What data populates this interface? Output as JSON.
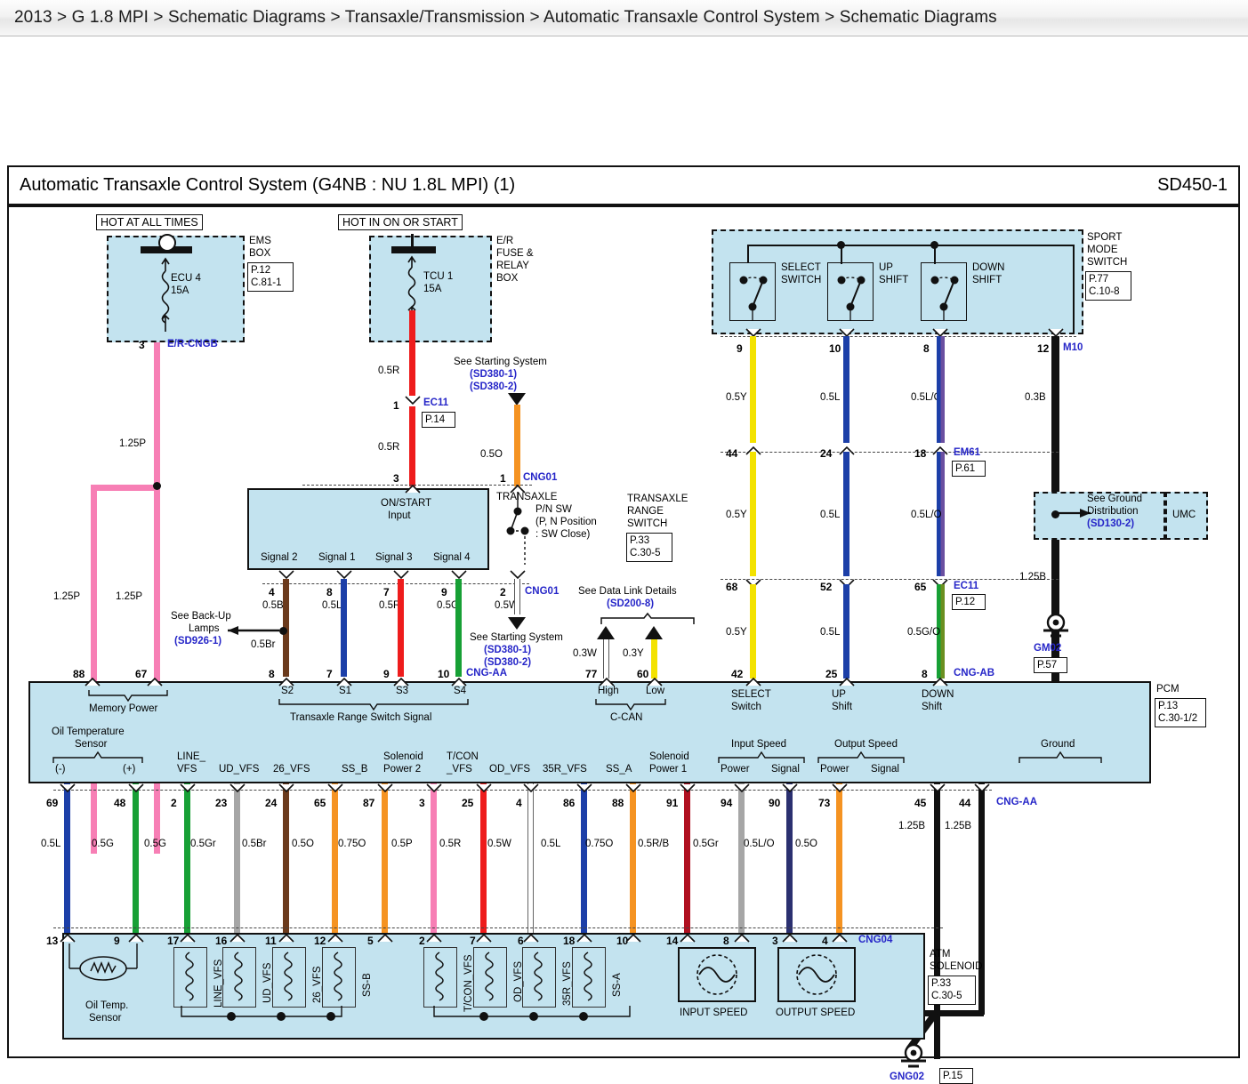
{
  "breadcrumb": {
    "text": "2013 > G 1.8 MPI > Schematic Diagrams > Transaxle/Transmission > Automatic Transaxle Control System > Schematic Diagrams"
  },
  "diagram": {
    "title": "Automatic Transaxle Control System (G4NB : NU 1.8L MPI) (1)",
    "sheet_code": "SD450-1"
  },
  "fuse_boxes": [
    {
      "banner": "HOT AT ALL TIMES",
      "fuse_name": "ECU 4",
      "fuse_rating": "15A",
      "box_name": "EMS\nBOX",
      "box_name_l1": "EMS",
      "box_name_l2": "BOX",
      "ref_page": "P.12",
      "ref_conn": "C.81-1",
      "out_pin": "3",
      "out_connector": "E/R-CNGB"
    },
    {
      "banner": "HOT IN ON OR START",
      "fuse_name": "TCU 1",
      "fuse_rating": "15A",
      "box_name_l1": "E/R",
      "box_name_l2": "FUSE &",
      "box_name_l3": "RELAY",
      "box_name_l4": "BOX",
      "out_wire": "0.5R"
    }
  ],
  "sport_mode_switch": {
    "title_l1": "SPORT",
    "title_l2": "MODE",
    "title_l3": "SWITCH",
    "ref_page": "P.77",
    "ref_conn": "C.10-8",
    "switches": [
      {
        "name_l1": "SELECT",
        "name_l2": "SWITCH",
        "pin": "9",
        "wire": "0.5Y",
        "color": "#f3e200"
      },
      {
        "name_l1": "UP",
        "name_l2": "SHIFT",
        "pin": "10",
        "wire": "0.5L",
        "color": "#1c3fa8"
      },
      {
        "name_l1": "DOWN",
        "name_l2": "SHIFT",
        "pin": "8",
        "wire": "0.5L/O",
        "color": "#1c3fa8"
      }
    ],
    "ground_pin": "12",
    "ground_connector": "M10",
    "ground_wire": "0.3B"
  },
  "mid_connectors": {
    "em61": {
      "name": "EM61",
      "page": "P.61",
      "pins": [
        "44",
        "24",
        "18"
      ]
    },
    "ec11_right": {
      "name": "EC11",
      "page": "P.12",
      "pins": [
        "68",
        "52",
        "65"
      ]
    },
    "cng_ab": {
      "name": "CNG-AB",
      "pins": [
        "42",
        "25",
        "8"
      ]
    },
    "wires_mid": [
      "0.5Y",
      "0.5L",
      "0.5L/O"
    ],
    "wires_low": [
      "0.5Y",
      "0.5L",
      "0.5G/O"
    ]
  },
  "ground_distribution": {
    "note_l1": "See Ground",
    "note_l2": "Distribution",
    "note_ref": "(SD130-2)",
    "box_label": "UMC",
    "wire_lower": "1.25B",
    "ground_name": "GM02",
    "ground_page": "P.57"
  },
  "transaxle_range_switch": {
    "title_l1": "TRANSAXLE",
    "title_l2": "RANGE",
    "title_l3": "SWITCH",
    "ref_page": "P.33",
    "ref_conn": "C.30-5",
    "on_start_l1": "ON/START",
    "on_start_l2": "Input",
    "pn_sw_l1": "P/N SW",
    "pn_sw_l2": "(P, N Position",
    "pn_sw_l3": ": SW Close)",
    "signal_labels": [
      "Signal 2",
      "Signal 1",
      "Signal 3",
      "Signal 4"
    ],
    "top_pins": {
      "on_start": "3",
      "pn_sw": "1"
    },
    "top_connector": "CNG01",
    "ec11": {
      "name": "EC11",
      "page": "P.14",
      "pin": "1"
    },
    "wire_in_upper": "0.5R",
    "wire_in_lower": "0.5R",
    "wire_pn": "0.5O",
    "starting_note_l1": "See Starting System",
    "starting_note_ref1": "(SD380-1)",
    "starting_note_ref2": "(SD380-2)",
    "out_pins": [
      "4",
      "8",
      "7",
      "9"
    ],
    "out_wires": [
      "0.5Br",
      "0.5L",
      "0.5R",
      "0.5G"
    ],
    "pn_out_pin": "2",
    "pn_out_wire": "0.5W",
    "pn_out_connector": "CNG01"
  },
  "backup_lamps": {
    "note_l1": "See Back-Up",
    "note_l2": "Lamps",
    "note_ref": "(SD926-1)",
    "wire_above": "0.5Br",
    "wire_below": "0.5Br"
  },
  "data_link": {
    "note": "See Data Link Details",
    "note_ref": "(SD200-8)",
    "wires": [
      "0.3W",
      "0.3Y"
    ],
    "pins": [
      "77",
      "60"
    ]
  },
  "memory_power": {
    "wire_top": "1.25P",
    "wire_left": "1.25P",
    "wire_right": "1.25P",
    "pins": [
      "88",
      "67"
    ]
  },
  "pcm": {
    "name": "PCM",
    "ref_page": "P.13",
    "ref_conn": "C.30-1/2",
    "top_groups": [
      {
        "label": "Memory Power",
        "sub": []
      },
      {
        "label": "Transaxle Range Switch Signal",
        "sub": [
          "S2",
          "S1",
          "S3",
          "S4"
        ]
      },
      {
        "label": "C-CAN",
        "sub": [
          "High",
          "Low"
        ]
      }
    ],
    "top_single": [
      {
        "l1": "SELECT",
        "l2": "Switch"
      },
      {
        "l1": "UP",
        "l2": "Shift"
      },
      {
        "l1": "DOWN",
        "l2": "Shift"
      }
    ],
    "bottom_groups": [
      {
        "label_l1": "Oil Temperature",
        "label_l2": "Sensor",
        "sub": [
          "(-)",
          "(+)"
        ]
      },
      {
        "label_l1": "Input Speed",
        "sub": [
          "Power",
          "Signal"
        ]
      },
      {
        "label_l1": "Output Speed",
        "sub": [
          "Power",
          "Signal"
        ]
      },
      {
        "label_l1": "Ground",
        "sub": []
      }
    ],
    "bottom_pin_labels": [
      "LINE_\nVFS",
      "UD_VFS",
      "26_VFS",
      "SS_B",
      "Solenoid\nPower 2",
      "T/CON\n_VFS",
      "OD_VFS",
      "35R_VFS",
      "SS_A",
      "Solenoid\nPower 1"
    ],
    "top_pins_left": [
      "88",
      "67",
      "8",
      "7",
      "9",
      "10",
      "77",
      "60",
      "42",
      "25",
      "8"
    ],
    "bottom_pins": [
      "69",
      "48",
      "2",
      "23",
      "24",
      "65",
      "87",
      "3",
      "25",
      "4",
      "86",
      "88",
      "91",
      "94",
      "90",
      "73",
      "45",
      "44"
    ],
    "bottom_wires": [
      "0.5L",
      "0.5G",
      "0.5G",
      "0.5Gr",
      "0.5Br",
      "0.5O",
      "0.75O",
      "0.5P",
      "0.5R",
      "0.5W",
      "0.5L",
      "0.75O",
      "0.5R/B",
      "0.5Gr",
      "0.5L/O",
      "0.5O",
      "1.25B",
      "1.25B"
    ],
    "bottom_connector": "CNG-AA"
  },
  "atm_solenoid": {
    "title_l1": "ATM",
    "title_l2": "SOLENOID",
    "ref_page": "P.33",
    "ref_conn": "C.30-5",
    "connector": "CNG04",
    "top_pins": [
      "13",
      "9",
      "17",
      "16",
      "11",
      "12",
      "5",
      "2",
      "7",
      "6",
      "18",
      "10",
      "14",
      "8",
      "3",
      "4"
    ],
    "oil_temp_l1": "Oil Temp.",
    "oil_temp_l2": "Sensor",
    "solenoid_names": [
      "LINE_VFS",
      "UD_VFS",
      "26_VFS",
      "SS-B",
      "T/CON_VFS",
      "OD_VFS",
      "35R_VFS",
      "SS-A"
    ],
    "speed_sensors": [
      "INPUT SPEED",
      "OUTPUT SPEED"
    ],
    "ground_name": "GNG02",
    "ground_page": "P.15"
  },
  "colors": {
    "box_fill": "#c3e3ef",
    "ref_blue": "#2626c8",
    "pink": "#f77fb5",
    "red": "#ee1c1c",
    "orange": "#f59322",
    "yellow": "#f3e200",
    "blue": "#1c3fa8",
    "green": "#17a035",
    "brown": "#6b3a1c",
    "gray": "#a6a6a6",
    "black": "#111111",
    "white_wire": "#ffffff",
    "lightblue": "#7f9fe0",
    "darkred": "#b01020",
    "darkblue": "#2b3070"
  }
}
